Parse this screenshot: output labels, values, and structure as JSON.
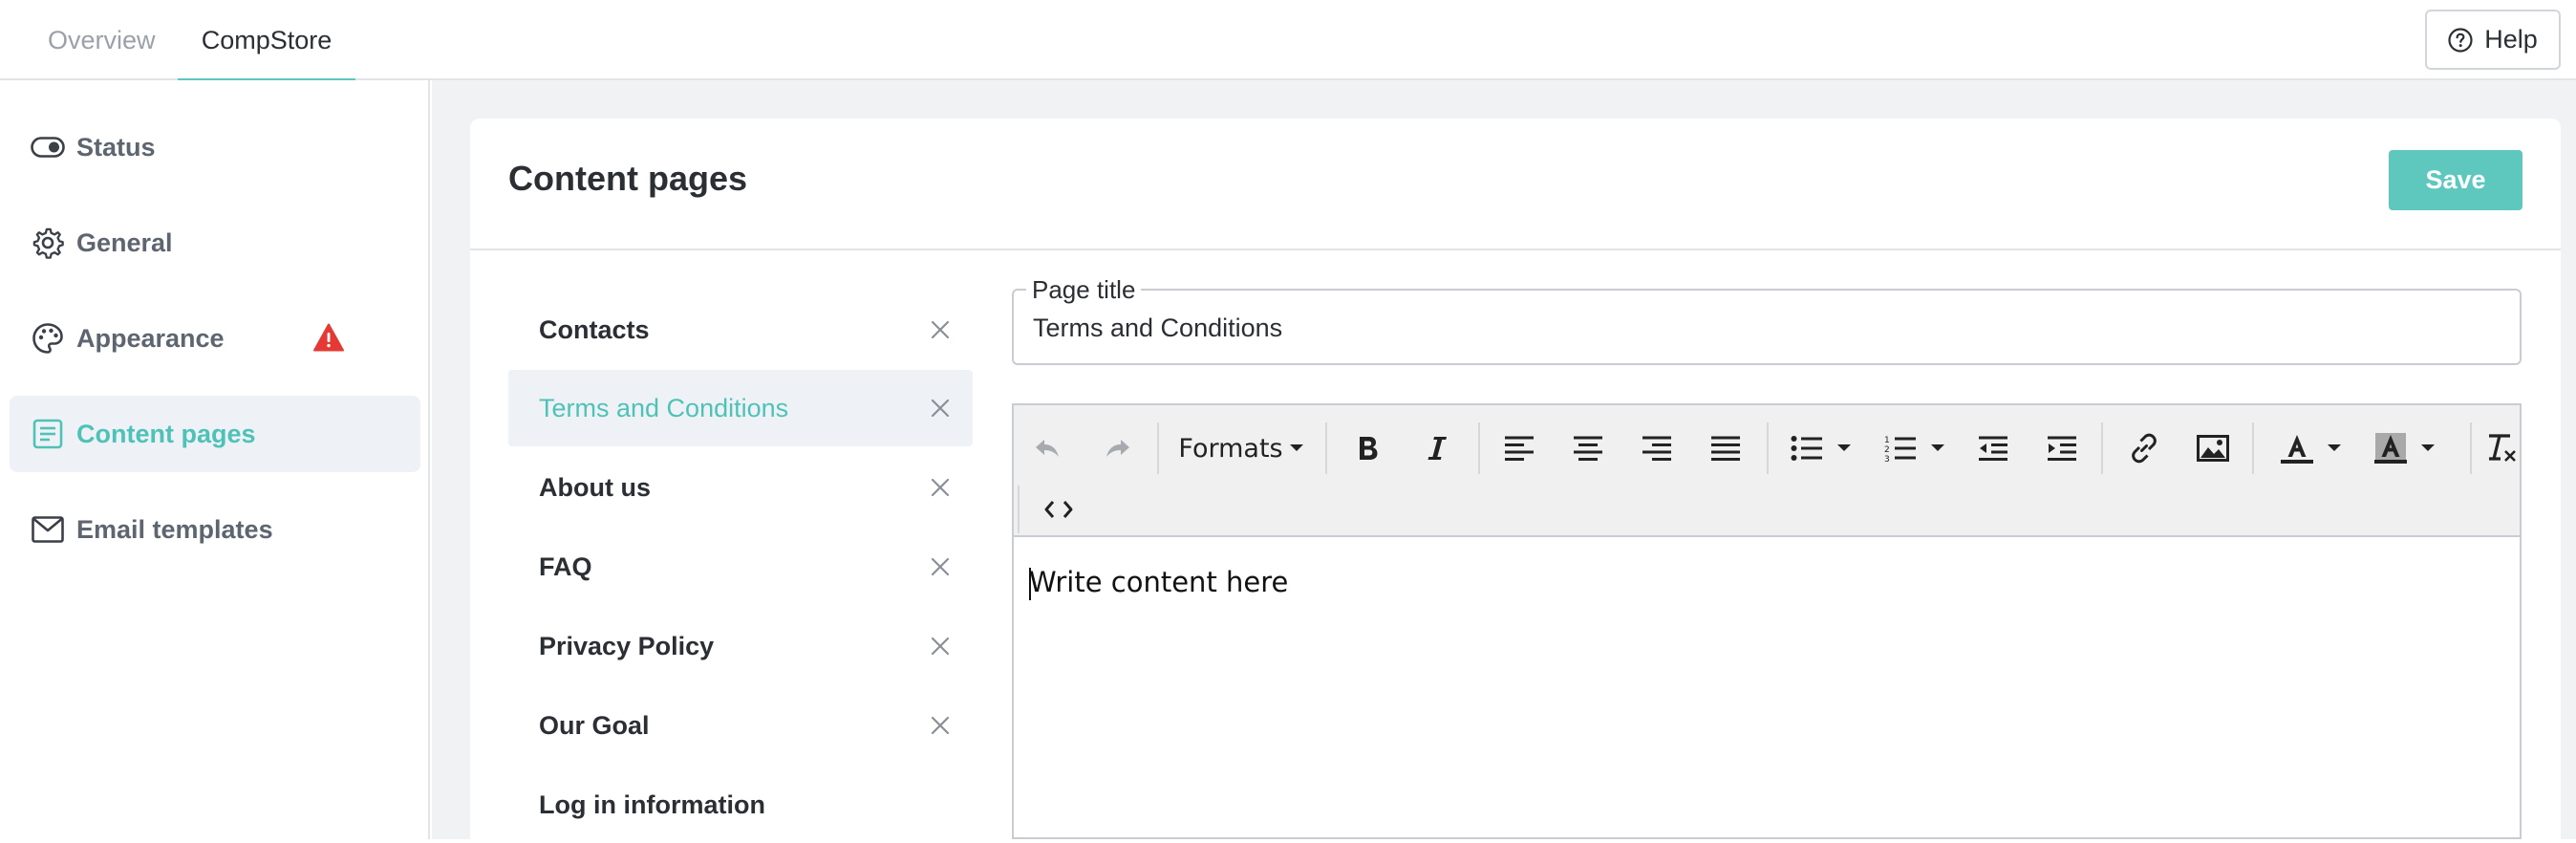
{
  "tabs": [
    {
      "label": "Overview"
    },
    {
      "label": "CompStore"
    }
  ],
  "help": {
    "label": "Help"
  },
  "sidebar": {
    "items": [
      {
        "label": "Status",
        "icon": "toggle-icon"
      },
      {
        "label": "General",
        "icon": "gear-icon"
      },
      {
        "label": "Appearance",
        "icon": "palette-icon",
        "badge": "warning-icon"
      },
      {
        "label": "Content pages",
        "icon": "document-icon"
      },
      {
        "label": "Email templates",
        "icon": "mail-icon"
      }
    ],
    "active": "Content pages"
  },
  "content": {
    "title": "Content pages",
    "save_label": "Save",
    "pages": [
      {
        "label": "Contacts"
      },
      {
        "label": "Terms and Conditions"
      },
      {
        "label": "About us"
      },
      {
        "label": "FAQ"
      },
      {
        "label": "Privacy Policy"
      },
      {
        "label": "Our Goal"
      },
      {
        "label": "Log in information"
      }
    ],
    "active_page": "Terms and Conditions",
    "page_title_label": "Page title",
    "page_title_value": "Terms and Conditions",
    "editor": {
      "formats_label": "Formats",
      "placeholder": "Write content here"
    }
  },
  "colors": {
    "accent": "#5ec8bf",
    "active_bg": "#eef2f7",
    "warning": "#e53935"
  }
}
